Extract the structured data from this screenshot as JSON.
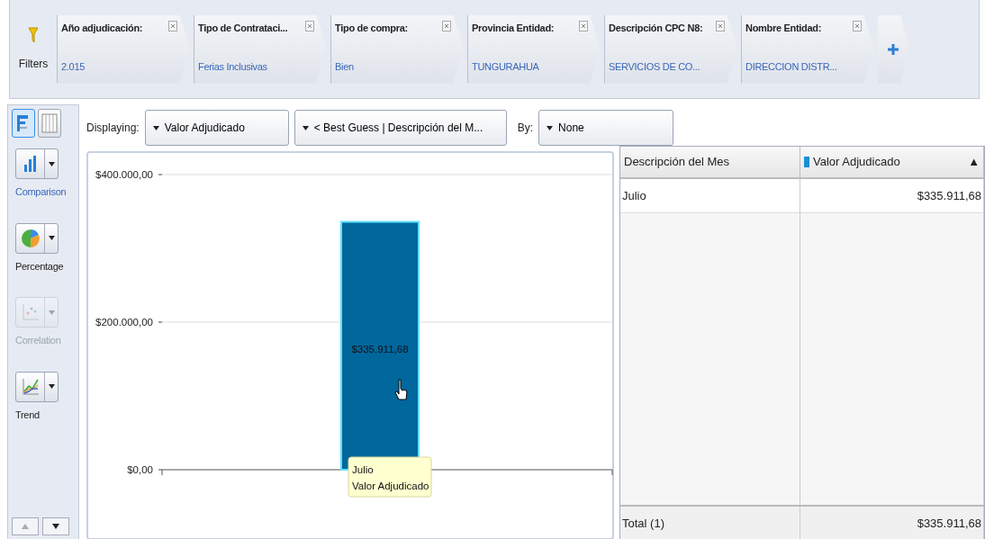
{
  "filter_bar": {
    "label": "Filters",
    "filters": [
      {
        "label": "Año adjudicación:",
        "value": "2.015"
      },
      {
        "label": "Tipo de Contrataci...",
        "value": "Ferias Inclusivas"
      },
      {
        "label": "Tipo de compra:",
        "value": "Bien"
      },
      {
        "label": "Provincia Entidad:",
        "value": "TUNGURAHUA"
      },
      {
        "label": "Descripción CPC N8:",
        "value": "SERVICIOS DE CO..."
      },
      {
        "label": "Nombre Entidad:",
        "value": "DIRECCION DISTR..."
      }
    ]
  },
  "view_toggles": [
    {
      "kind": "chart",
      "selected": true
    },
    {
      "kind": "table",
      "selected": false
    }
  ],
  "chart_types": [
    {
      "kind": "bar",
      "label": "Comparison",
      "selected": true,
      "disabled": false
    },
    {
      "kind": "pie",
      "label": "Percentage",
      "selected": false,
      "disabled": false
    },
    {
      "kind": "scatter",
      "label": "Correlation",
      "selected": false,
      "disabled": true
    },
    {
      "kind": "line",
      "label": "Trend",
      "selected": false,
      "disabled": false
    }
  ],
  "toolbar": {
    "displaying_label": "Displaying:",
    "measure": "Valor Adjudicado",
    "dimension": "< Best Guess | Descripción del M...",
    "by_label": "By:",
    "by": "None"
  },
  "chart": {
    "chart_data": {
      "type": "bar",
      "categories": [
        "Julio"
      ],
      "series": [
        {
          "name": "Valor Adjudicado",
          "color": "#00679c",
          "values": [
            335911.68
          ]
        }
      ],
      "ylim": [
        0,
        400000
      ],
      "yticks": [
        {
          "value": 0,
          "label": "$0,00"
        },
        {
          "value": 200000,
          "label": "$200.000,00"
        },
        {
          "value": 400000,
          "label": "$400.000,00"
        }
      ],
      "value_labels": [
        "$335.911,68"
      ]
    }
  },
  "table": {
    "columns": [
      {
        "label": "Descripción del Mes"
      },
      {
        "label": "Valor Adjudicado",
        "color": "#1a8fd6",
        "sort": "▲"
      }
    ],
    "rows": [
      [
        "Julio",
        "$335.911,68"
      ]
    ],
    "total": [
      "Total (1)",
      "$335.911,68"
    ]
  }
}
